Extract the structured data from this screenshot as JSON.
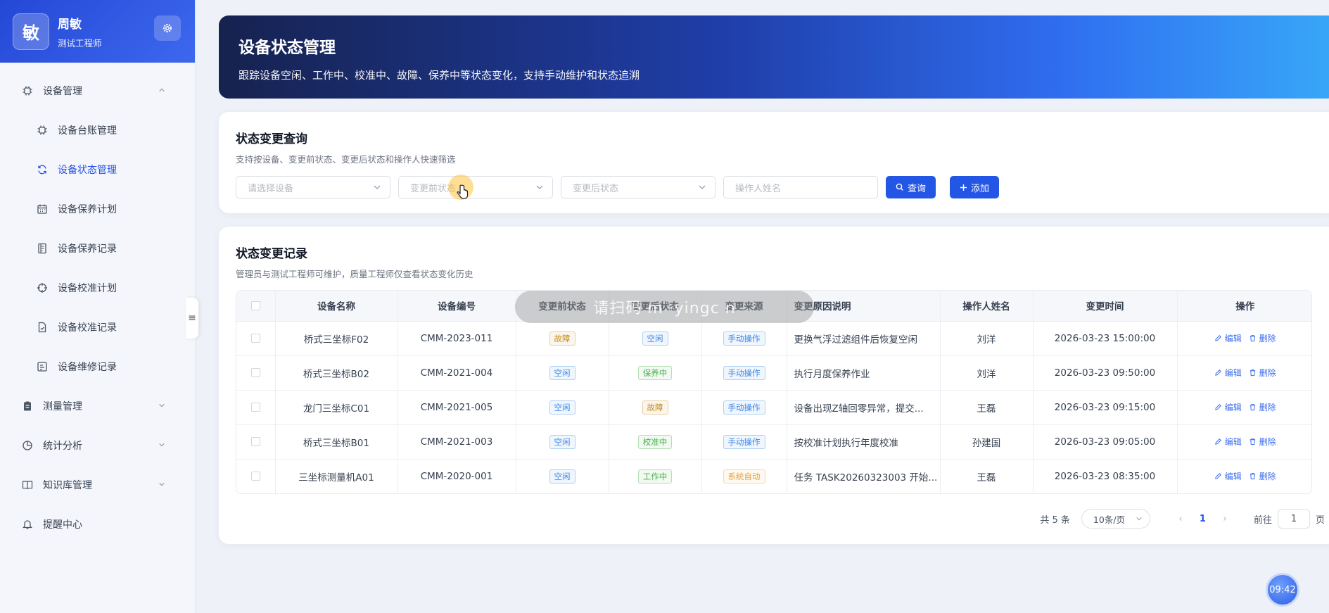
{
  "profile": {
    "avatar_char": "敏",
    "name": "周敏",
    "role": "测试工程师"
  },
  "sidebar": {
    "items": [
      {
        "label": "设备管理",
        "level": "top",
        "icon": "chip-icon",
        "chevron": "up"
      },
      {
        "label": "设备台账管理",
        "level": "sub",
        "icon": "chip-icon"
      },
      {
        "label": "设备状态管理",
        "level": "sub",
        "icon": "refresh-icon",
        "active": true
      },
      {
        "label": "设备保养计划",
        "level": "sub",
        "icon": "calendar-icon"
      },
      {
        "label": "设备保养记录",
        "level": "sub",
        "icon": "document-icon"
      },
      {
        "label": "设备校准计划",
        "level": "sub",
        "icon": "target-icon"
      },
      {
        "label": "设备校准记录",
        "level": "sub",
        "icon": "file-check-icon"
      },
      {
        "label": "设备维修记录",
        "level": "sub",
        "icon": "repair-icon"
      },
      {
        "label": "测量管理",
        "level": "top",
        "icon": "clipboard-icon",
        "chevron": "down"
      },
      {
        "label": "统计分析",
        "level": "top",
        "icon": "pie-chart-icon",
        "chevron": "down"
      },
      {
        "label": "知识库管理",
        "level": "top",
        "icon": "book-icon",
        "chevron": "down"
      },
      {
        "label": "提醒中心",
        "level": "top",
        "icon": "bell-icon"
      }
    ]
  },
  "hero": {
    "title": "设备状态管理",
    "subtitle": "跟踪设备空闲、工作中、校准中、故障、保养中等状态变化，支持手动维护和状态追溯"
  },
  "query": {
    "title": "状态变更查询",
    "subtitle": "支持按设备、变更前状态、变更后状态和操作人快速筛选",
    "device_placeholder": "请选择设备",
    "before_placeholder": "变更前状态",
    "after_placeholder": "变更后状态",
    "operator_placeholder": "操作人姓名",
    "search_label": "查询",
    "add_label": "添加"
  },
  "records": {
    "title": "状态变更记录",
    "subtitle": "管理员与测试工程师可维护，质量工程师仅查看状态变化历史",
    "columns": [
      "设备名称",
      "设备编号",
      "变更前状态",
      "变更后状态",
      "变更来源",
      "变更原因说明",
      "操作人姓名",
      "变更时间",
      "操作"
    ],
    "rows": [
      {
        "name": "桥式三坐标F02",
        "code": "CMM-2023-011",
        "before": "故障",
        "after": "空闲",
        "source": "手动操作",
        "reason": "更换气浮过滤组件后恢复空闲",
        "operator": "刘洋",
        "time": "2026-03-23 15:00:00"
      },
      {
        "name": "桥式三坐标B02",
        "code": "CMM-2021-004",
        "before": "空闲",
        "after": "保养中",
        "source": "手动操作",
        "reason": "执行月度保养作业",
        "operator": "刘洋",
        "time": "2026-03-23 09:50:00"
      },
      {
        "name": "龙门三坐标C01",
        "code": "CMM-2021-005",
        "before": "空闲",
        "after": "故障",
        "source": "手动操作",
        "reason": "设备出现Z轴回零异常，提交...",
        "operator": "王磊",
        "time": "2026-03-23 09:15:00"
      },
      {
        "name": "桥式三坐标B01",
        "code": "CMM-2021-003",
        "before": "空闲",
        "after": "校准中",
        "source": "手动操作",
        "reason": "按校准计划执行年度校准",
        "operator": "孙建国",
        "time": "2026-03-23 09:05:00"
      },
      {
        "name": "三坐标测量机A01",
        "code": "CMM-2020-001",
        "before": "空闲",
        "after": "工作中",
        "source": "系统自动",
        "reason": "任务 TASK20260323003 开始...",
        "operator": "王磊",
        "time": "2026-03-23 08:35:00"
      }
    ],
    "edit_label": "编辑",
    "delete_label": "删除"
  },
  "status_colors": {
    "故障": "#c58a1a",
    "空闲": "#3a86e8",
    "保养中": "#4caf50",
    "校准中": "#4caf50",
    "工作中": "#4caf50",
    "手动操作": "#3a86e8",
    "系统自动": "#e6a23c"
  },
  "pagination": {
    "total": "共 5 条",
    "page_size": "10条/页",
    "current": "1",
    "goto_prefix": "前往",
    "goto_value": "1",
    "goto_suffix": "页"
  },
  "overlay": {
    "text": "请扫码 m    ·yingc    n"
  },
  "clock": {
    "time": "09:42"
  }
}
